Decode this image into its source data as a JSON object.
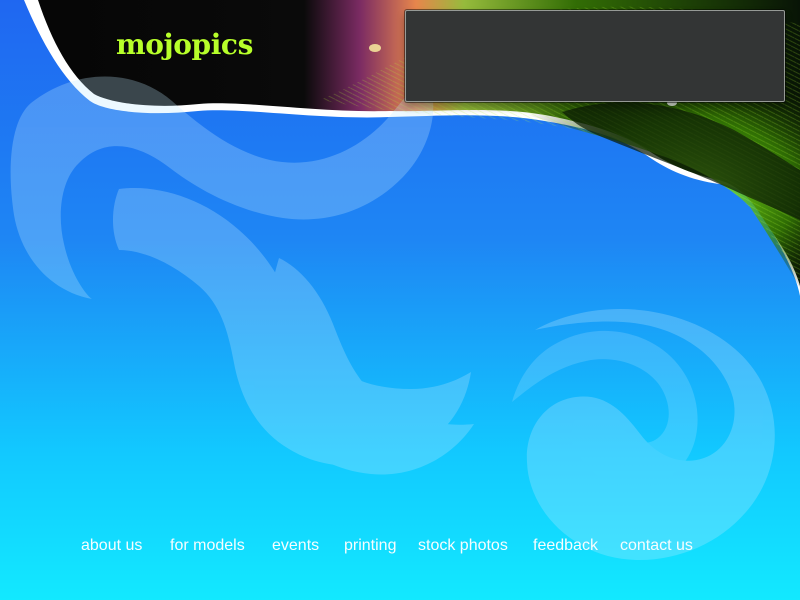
{
  "site": {
    "logo_text": "mojopics"
  },
  "navigation": {
    "items": [
      {
        "label": "about us"
      },
      {
        "label": "for models"
      },
      {
        "label": "events"
      },
      {
        "label": "printing"
      },
      {
        "label": "stock photos"
      },
      {
        "label": "feedback"
      },
      {
        "label": "contact us"
      }
    ]
  },
  "theme": {
    "background_top": "#1f67f1",
    "background_bottom": "#12e9ff",
    "logo_color": "#b7ff2a",
    "panel_color": "#333535",
    "nav_text_color": "#f6fdff"
  }
}
